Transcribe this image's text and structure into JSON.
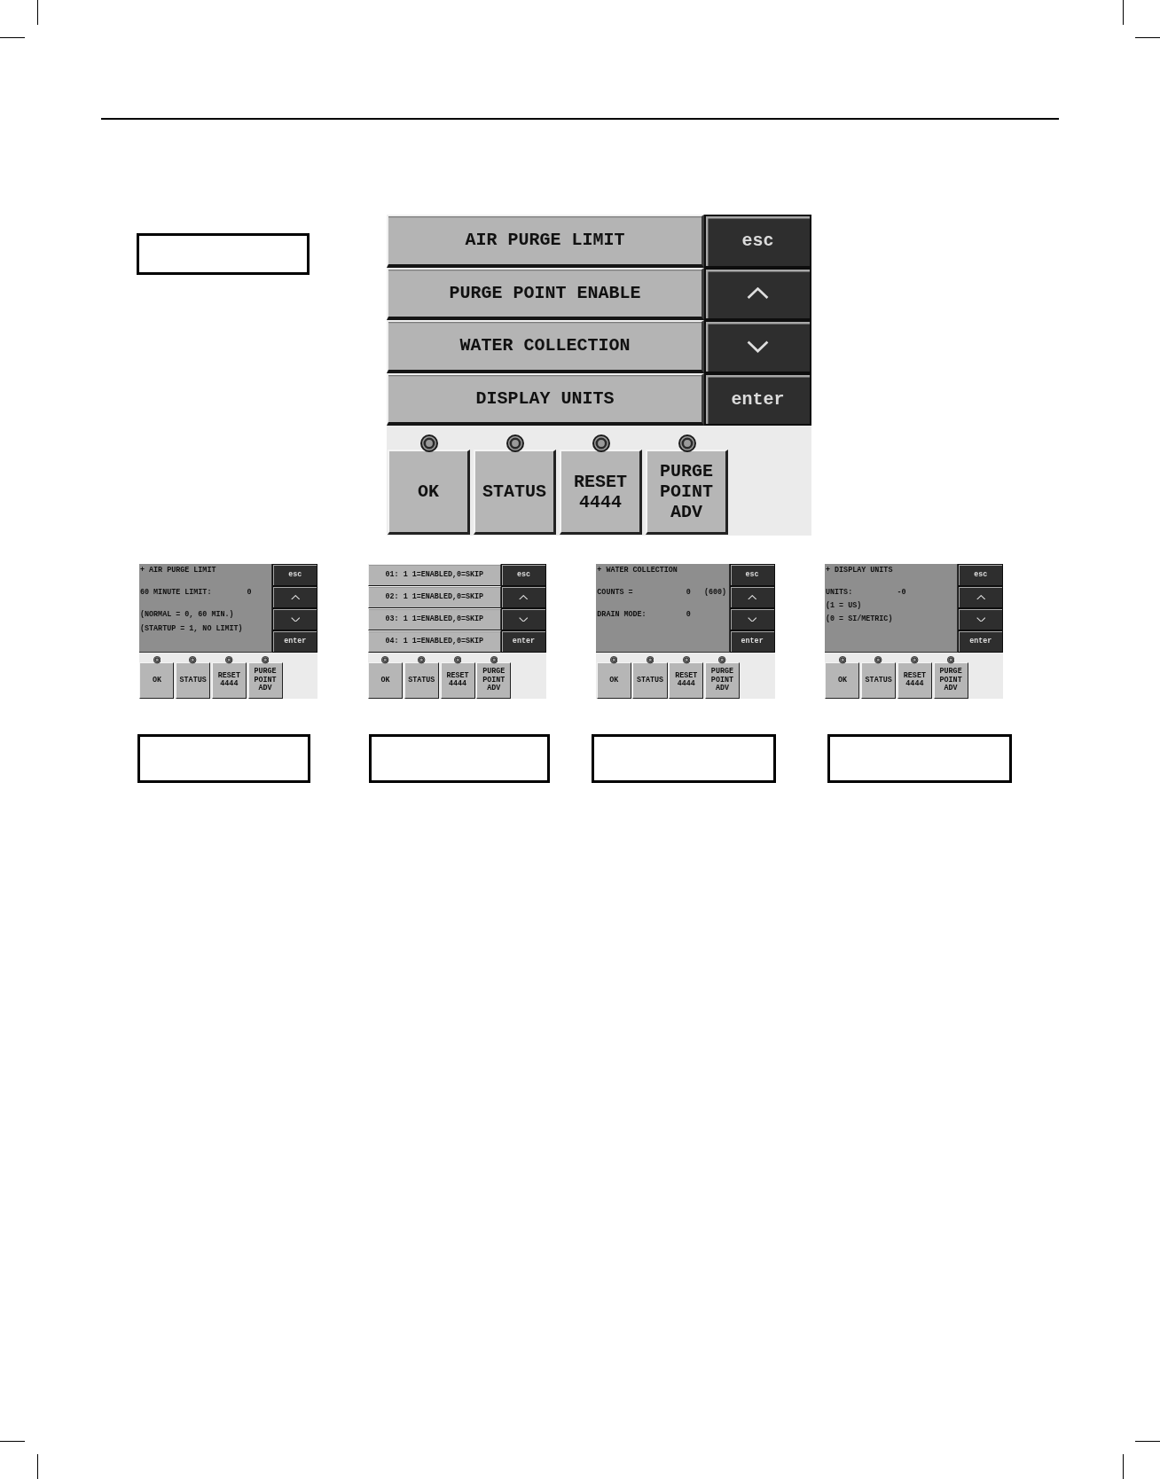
{
  "main_screen": {
    "kind": "menu",
    "menu_items": [
      "AIR PURGE LIMIT",
      "PURGE POINT ENABLE",
      "WATER COLLECTION",
      "DISPLAY UNITS"
    ],
    "nav_keys": [
      {
        "kind": "text",
        "label": "esc"
      },
      {
        "kind": "up"
      },
      {
        "kind": "down"
      },
      {
        "kind": "text",
        "label": "enter"
      }
    ],
    "function_buttons": [
      {
        "lines": [
          "OK"
        ]
      },
      {
        "lines": [
          "STATUS"
        ]
      },
      {
        "lines": [
          "RESET",
          "4444"
        ]
      },
      {
        "lines": [
          "PURGE",
          "POINT",
          "ADV"
        ]
      }
    ]
  },
  "sub_screens": [
    {
      "kind": "readout",
      "title": "+ AIR PURGE LIMIT",
      "paragraphs": [
        [
          "60 MINUTE LIMIT:        0"
        ],
        [
          "(NORMAL = 0, 60 MIN.)",
          "(STARTUP = 1, NO LIMIT)"
        ]
      ],
      "nav_keys": [
        {
          "kind": "text",
          "label": "esc"
        },
        {
          "kind": "up"
        },
        {
          "kind": "down"
        },
        {
          "kind": "text",
          "label": "enter"
        }
      ],
      "function_buttons": [
        {
          "lines": [
            "OK"
          ]
        },
        {
          "lines": [
            "STATUS"
          ]
        },
        {
          "lines": [
            "RESET",
            "4444"
          ]
        },
        {
          "lines": [
            "PURGE",
            "POINT",
            "ADV"
          ]
        }
      ]
    },
    {
      "kind": "menu",
      "menu_items": [
        "01: 1 1=ENABLED,0=SKIP",
        "02: 1 1=ENABLED,0=SKIP",
        "03: 1 1=ENABLED,0=SKIP",
        "04: 1 1=ENABLED,0=SKIP"
      ],
      "nav_keys": [
        {
          "kind": "text",
          "label": "esc"
        },
        {
          "kind": "up"
        },
        {
          "kind": "down"
        },
        {
          "kind": "text",
          "label": "enter"
        }
      ],
      "function_buttons": [
        {
          "lines": [
            "OK"
          ]
        },
        {
          "lines": [
            "STATUS"
          ]
        },
        {
          "lines": [
            "RESET",
            "4444"
          ]
        },
        {
          "lines": [
            "PURGE",
            "POINT",
            "ADV"
          ]
        }
      ]
    },
    {
      "kind": "readout",
      "title": "+ WATER COLLECTION",
      "paragraphs": [
        [
          "COUNTS =            0   (600)"
        ],
        [
          "DRAIN MODE:         0"
        ]
      ],
      "nav_keys": [
        {
          "kind": "text",
          "label": "esc"
        },
        {
          "kind": "up"
        },
        {
          "kind": "down"
        },
        {
          "kind": "text",
          "label": "enter"
        }
      ],
      "function_buttons": [
        {
          "lines": [
            "OK"
          ]
        },
        {
          "lines": [
            "STATUS"
          ]
        },
        {
          "lines": [
            "RESET",
            "4444"
          ]
        },
        {
          "lines": [
            "PURGE",
            "POINT",
            "ADV"
          ]
        }
      ]
    },
    {
      "kind": "readout",
      "title": "+ DISPLAY UNITS",
      "paragraphs": [
        [
          "UNITS:          -0",
          "(1 = US)",
          "(0 = SI/METRIC)"
        ]
      ],
      "nav_keys": [
        {
          "kind": "text",
          "label": "esc"
        },
        {
          "kind": "up"
        },
        {
          "kind": "down"
        },
        {
          "kind": "text",
          "label": "enter"
        }
      ],
      "function_buttons": [
        {
          "lines": [
            "OK"
          ]
        },
        {
          "lines": [
            "STATUS"
          ]
        },
        {
          "lines": [
            "RESET",
            "4444"
          ]
        },
        {
          "lines": [
            "PURGE",
            "POINT",
            "ADV"
          ]
        }
      ]
    }
  ]
}
